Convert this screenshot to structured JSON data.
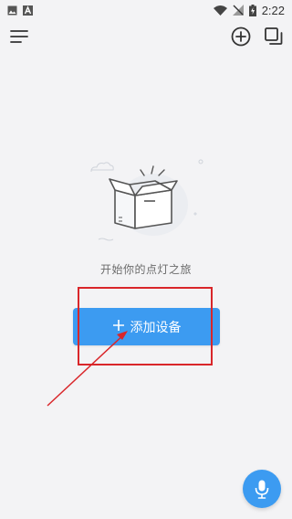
{
  "status_bar": {
    "time": "2:22",
    "icons": [
      "image-icon",
      "font-a-icon",
      "wifi-icon",
      "no-signal-icon",
      "battery-charging-icon"
    ]
  },
  "toolbar": {
    "menu_icon": "menu-icon",
    "add_icon": "plus-circle-icon",
    "copy_icon": "copy-icon"
  },
  "empty_state": {
    "illustration": "open-box-icon",
    "message": "开始你的点灯之旅"
  },
  "add_device_button": {
    "icon": "plus-icon",
    "label": "添加设备"
  },
  "annotation": {
    "color": "#d9262a"
  },
  "voice_button": {
    "icon": "microphone-icon"
  },
  "colors": {
    "accent": "#3c9bf1",
    "background": "#f3f3f5"
  }
}
